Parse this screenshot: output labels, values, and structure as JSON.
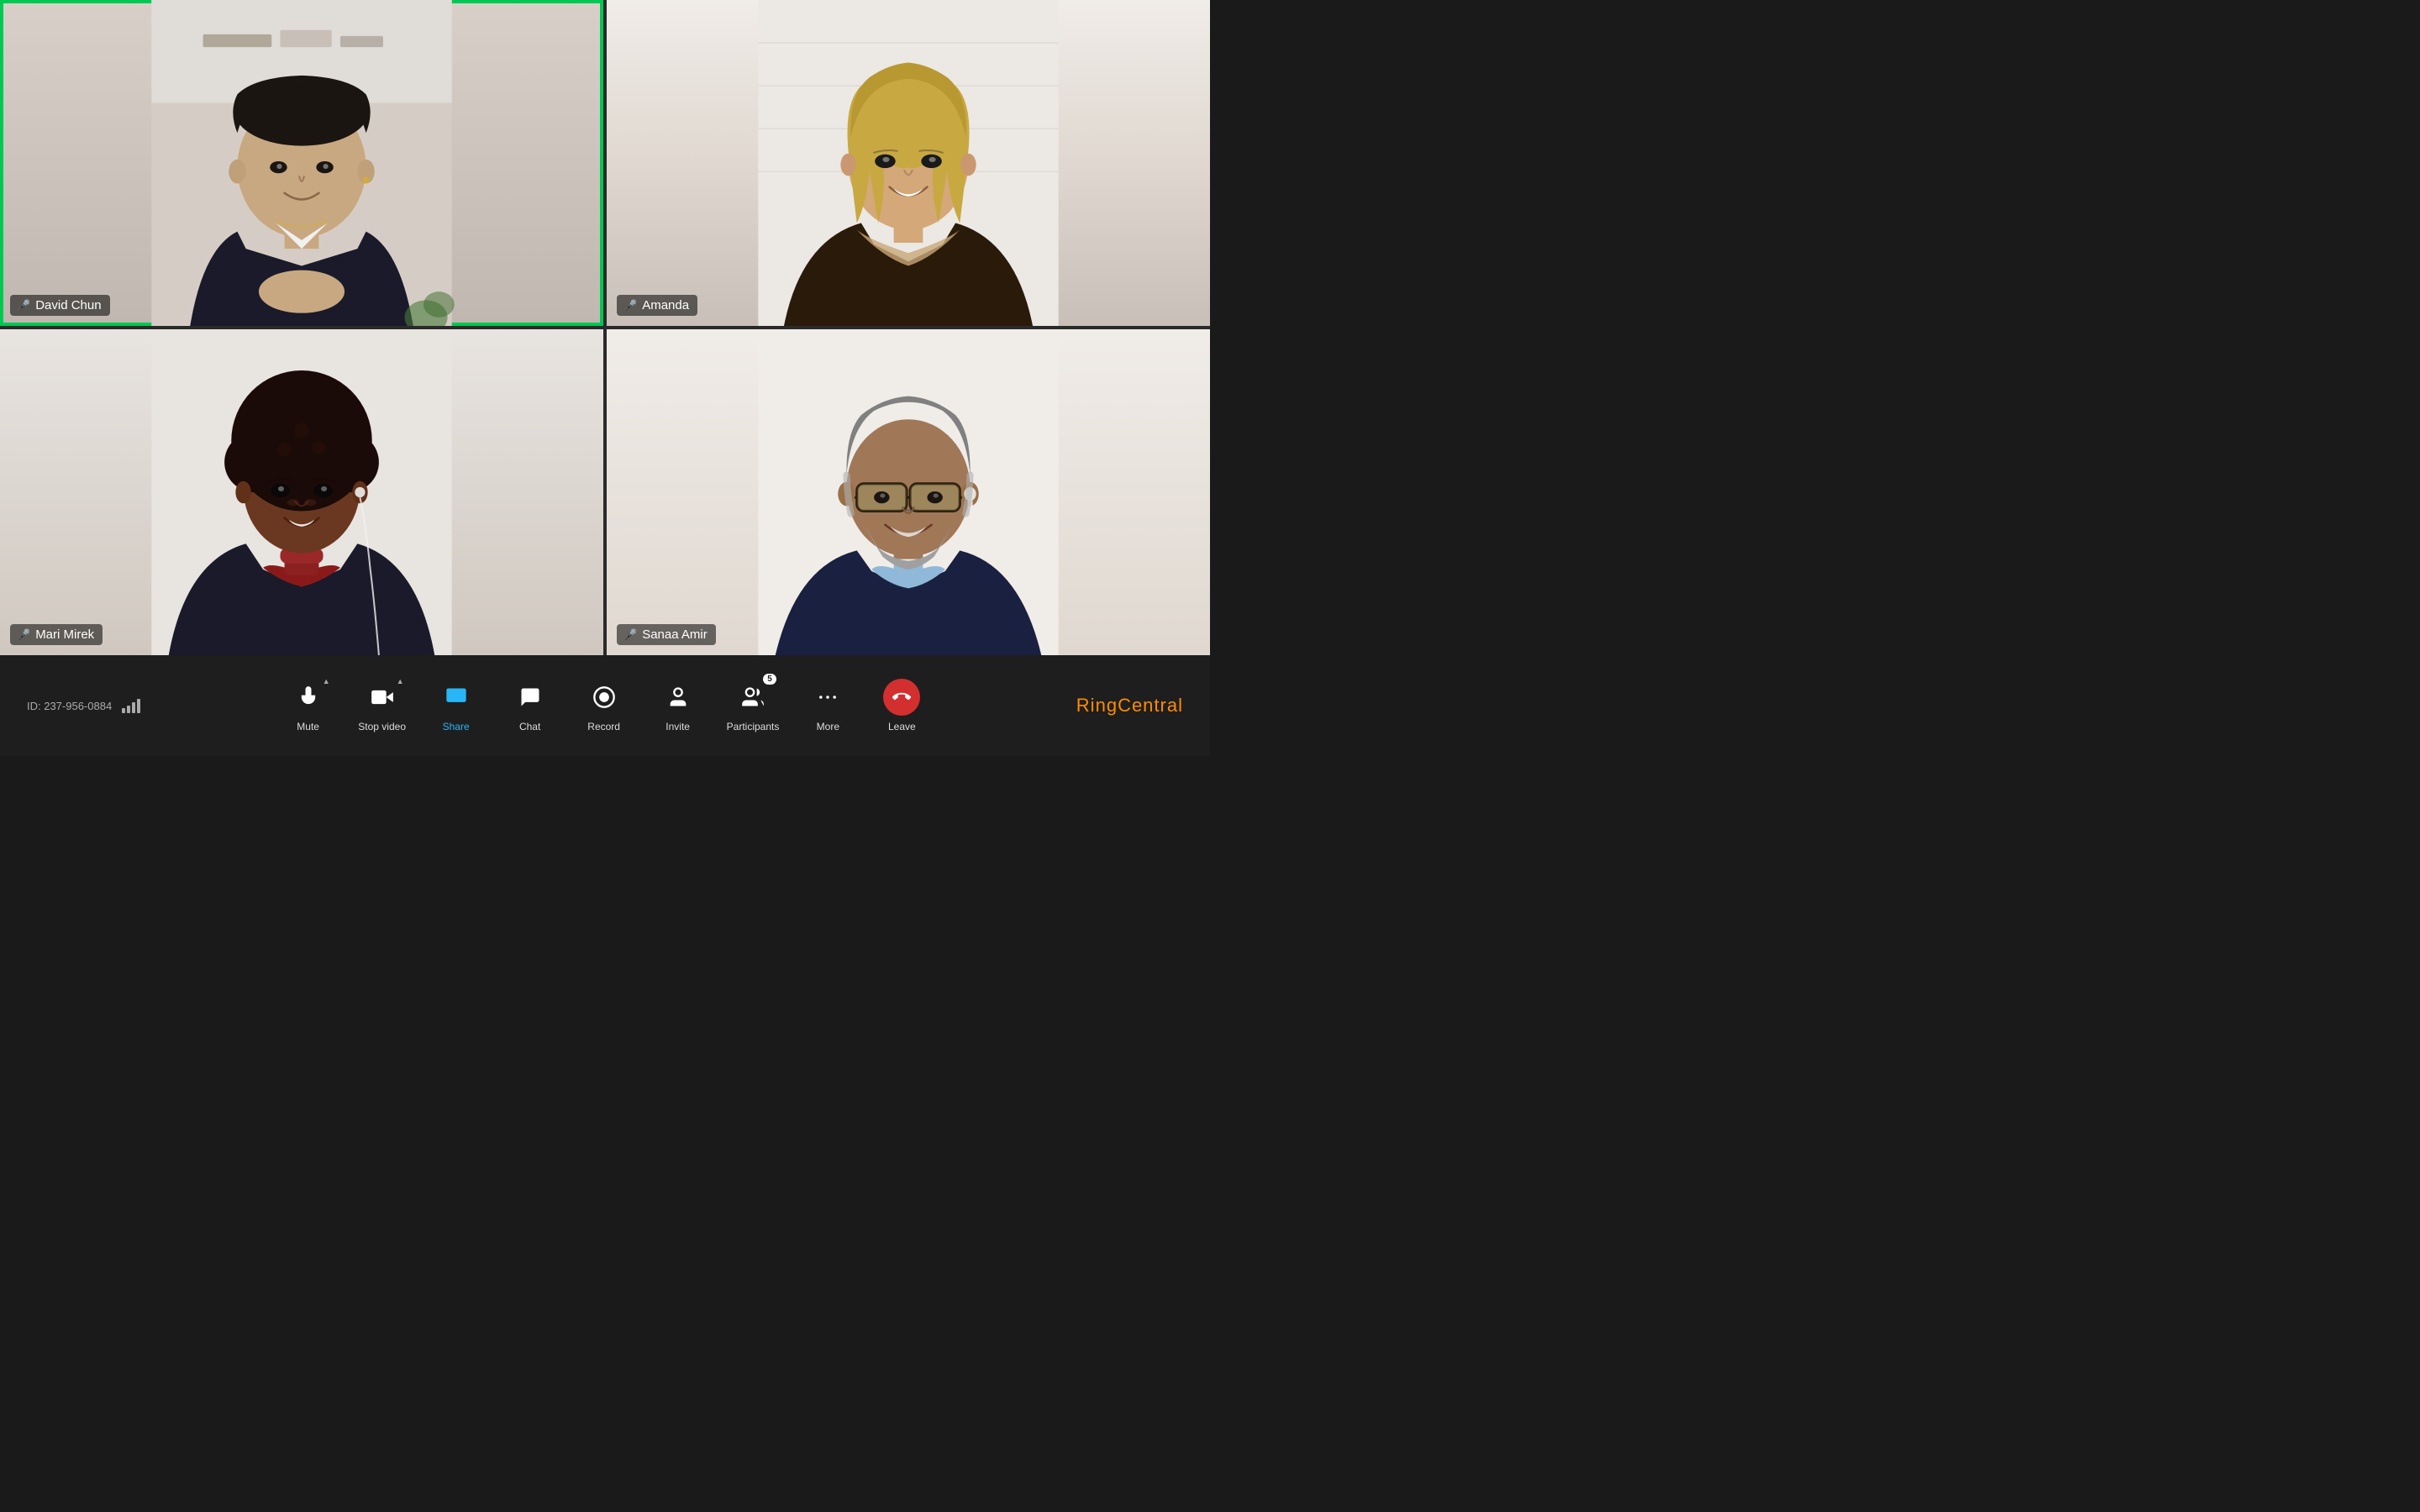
{
  "meeting": {
    "id_label": "ID: 237-956-0884",
    "participants": [
      {
        "id": "david",
        "name": "David Chun",
        "mic_active": true,
        "mic_muted": false,
        "active_speaker": true,
        "position": "top-left"
      },
      {
        "id": "amanda",
        "name": "Amanda",
        "mic_active": false,
        "mic_muted": true,
        "active_speaker": false,
        "position": "top-right"
      },
      {
        "id": "mari",
        "name": "Mari Mirek",
        "mic_active": true,
        "mic_muted": false,
        "active_speaker": false,
        "position": "bottom-left"
      },
      {
        "id": "sanaa",
        "name": "Sanaa Amir",
        "mic_active": true,
        "mic_muted": false,
        "active_speaker": false,
        "position": "bottom-right"
      }
    ]
  },
  "toolbar": {
    "mute_label": "Mute",
    "stop_video_label": "Stop video",
    "share_label": "Share",
    "chat_label": "Chat",
    "record_label": "Record",
    "invite_label": "Invite",
    "participants_label": "Participants",
    "participants_count": "5",
    "more_label": "More",
    "leave_label": "Leave"
  },
  "brand": {
    "name": "RingCentral",
    "ring": "Ring",
    "central": "Central"
  },
  "colors": {
    "active_speaker_border": "#00c853",
    "toolbar_bg": "#1e1e1e",
    "leave_bg": "#d32f2f",
    "active_icon": "#29b6f6"
  }
}
